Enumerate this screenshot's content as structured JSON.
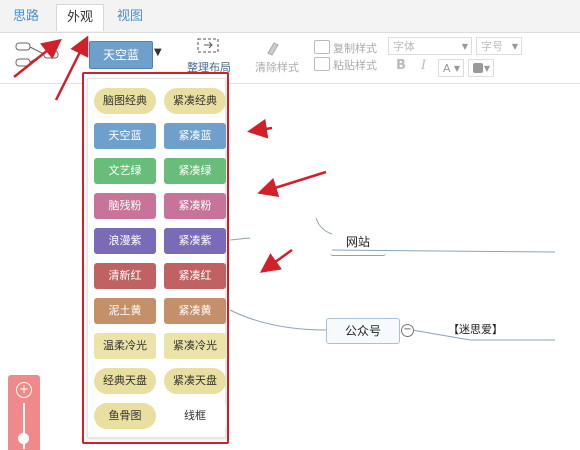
{
  "tabs": [
    {
      "label": "思路"
    },
    {
      "label": "外观"
    },
    {
      "label": "视图"
    }
  ],
  "toolbar": {
    "theme_label": "天空蓝",
    "arrange_label": "整理布局",
    "clear_style_label": "清除样式",
    "copy_style_label": "复制样式",
    "paste_style_label": "粘贴样式",
    "font_placeholder": "字体",
    "size_placeholder": "字号",
    "bold": "B",
    "italic": "I"
  },
  "theme_menu": {
    "items": [
      {
        "label": "脑图经典",
        "bg": "#e8dfa0",
        "fg": "#333",
        "shape": "pill"
      },
      {
        "label": "紧凑经典",
        "bg": "#e8dfa0",
        "fg": "#333",
        "shape": "pill"
      },
      {
        "label": "天空蓝",
        "bg": "#6f9fcb",
        "fg": "#fff",
        "shape": "rect"
      },
      {
        "label": "紧凑蓝",
        "bg": "#6f9fcb",
        "fg": "#fff",
        "shape": "rect"
      },
      {
        "label": "文艺绿",
        "bg": "#68bd7a",
        "fg": "#fff",
        "shape": "rect"
      },
      {
        "label": "紧凑绿",
        "bg": "#68bd7a",
        "fg": "#fff",
        "shape": "rect"
      },
      {
        "label": "脑残粉",
        "bg": "#c8739a",
        "fg": "#fff",
        "shape": "rect"
      },
      {
        "label": "紧凑粉",
        "bg": "#c8739a",
        "fg": "#fff",
        "shape": "rect"
      },
      {
        "label": "浪漫紫",
        "bg": "#7a6ab8",
        "fg": "#fff",
        "shape": "rect"
      },
      {
        "label": "紧凑紫",
        "bg": "#7a6ab8",
        "fg": "#fff",
        "shape": "rect"
      },
      {
        "label": "清新红",
        "bg": "#c06264",
        "fg": "#fff",
        "shape": "rect"
      },
      {
        "label": "紧凑红",
        "bg": "#c06264",
        "fg": "#fff",
        "shape": "rect"
      },
      {
        "label": "泥土黄",
        "bg": "#c4906a",
        "fg": "#fff",
        "shape": "rect"
      },
      {
        "label": "紧凑黄",
        "bg": "#c4906a",
        "fg": "#fff",
        "shape": "rect"
      },
      {
        "label": "温柔冷光",
        "bg": "#ebe3a8",
        "fg": "#333",
        "shape": "rect"
      },
      {
        "label": "紧凑冷光",
        "bg": "#ebe3a8",
        "fg": "#333",
        "shape": "rect"
      },
      {
        "label": "经典天盘",
        "bg": "#e8dfa0",
        "fg": "#333",
        "shape": "pill"
      },
      {
        "label": "紧凑天盘",
        "bg": "#e8dfa0",
        "fg": "#333",
        "shape": "pill"
      },
      {
        "label": "鱼骨图",
        "bg": "#e8dfa0",
        "fg": "#333",
        "shape": "pill"
      },
      {
        "label": "线框",
        "bg": "#ffffff",
        "fg": "#333",
        "shape": "plain"
      }
    ]
  },
  "mindmap": {
    "node_website": "网站",
    "node_public": "公众号",
    "node_child": "【迷思爱】"
  },
  "colors": {
    "accent_blue": "#6f9fcb",
    "annotation_red": "#d0202a"
  }
}
